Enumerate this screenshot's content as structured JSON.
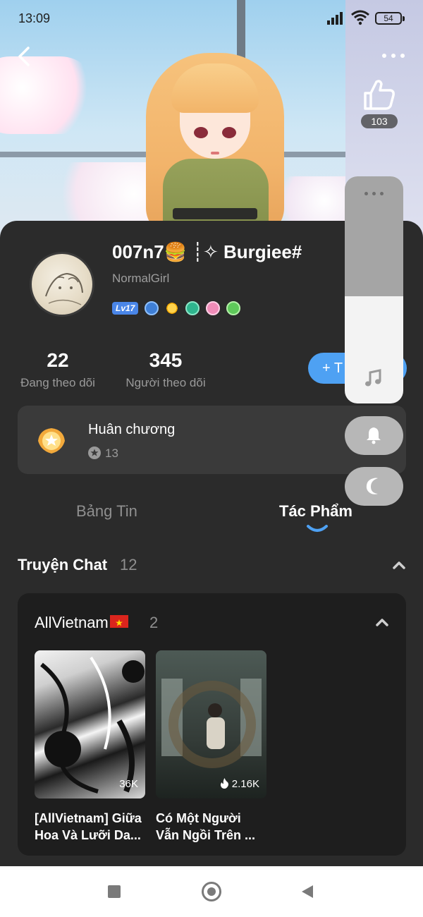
{
  "status_bar": {
    "time": "13:09",
    "battery": "54"
  },
  "header": {
    "like_count": "103"
  },
  "profile": {
    "display_name": "007n7🍔 ┊✧ Burgiee#",
    "subtitle": "NormalGirl",
    "level_badge": "Lv17",
    "stats": [
      {
        "value": "22",
        "label": "Đang theo dõi"
      },
      {
        "value": "345",
        "label": "Người theo dõi"
      }
    ],
    "follow_button_label": "+ T"
  },
  "medals": {
    "title": "Huân chương",
    "count": "13"
  },
  "tabs": [
    {
      "label": "Bảng Tin",
      "active": false
    },
    {
      "label": "Tác Phẩm",
      "active": true
    }
  ],
  "chat_stories": {
    "title": "Truyện Chat",
    "count": "12",
    "group": {
      "name": "AllVietnam",
      "count": "2",
      "stories": [
        {
          "title_line1": "[AllVietnam] Giữa",
          "title_line2": "Hoa Và Lưỡi Da...",
          "views": "36K"
        },
        {
          "title_line1": "Có Một Người",
          "title_line2": "Vẫn Ngồi Trên ...",
          "views": "2.16K"
        }
      ]
    }
  },
  "colors": {
    "accent": "#4ea1f3",
    "card_bg": "#2b2b2b",
    "inner_bg": "#1e1e1e",
    "muted_text": "#9a9a9a"
  },
  "icons": [
    "back-icon",
    "more-icon",
    "thumbs-up-icon",
    "music-note-icon",
    "bell-icon",
    "moon-icon",
    "fire-icon",
    "star-icon",
    "chevron-up-icon"
  ]
}
